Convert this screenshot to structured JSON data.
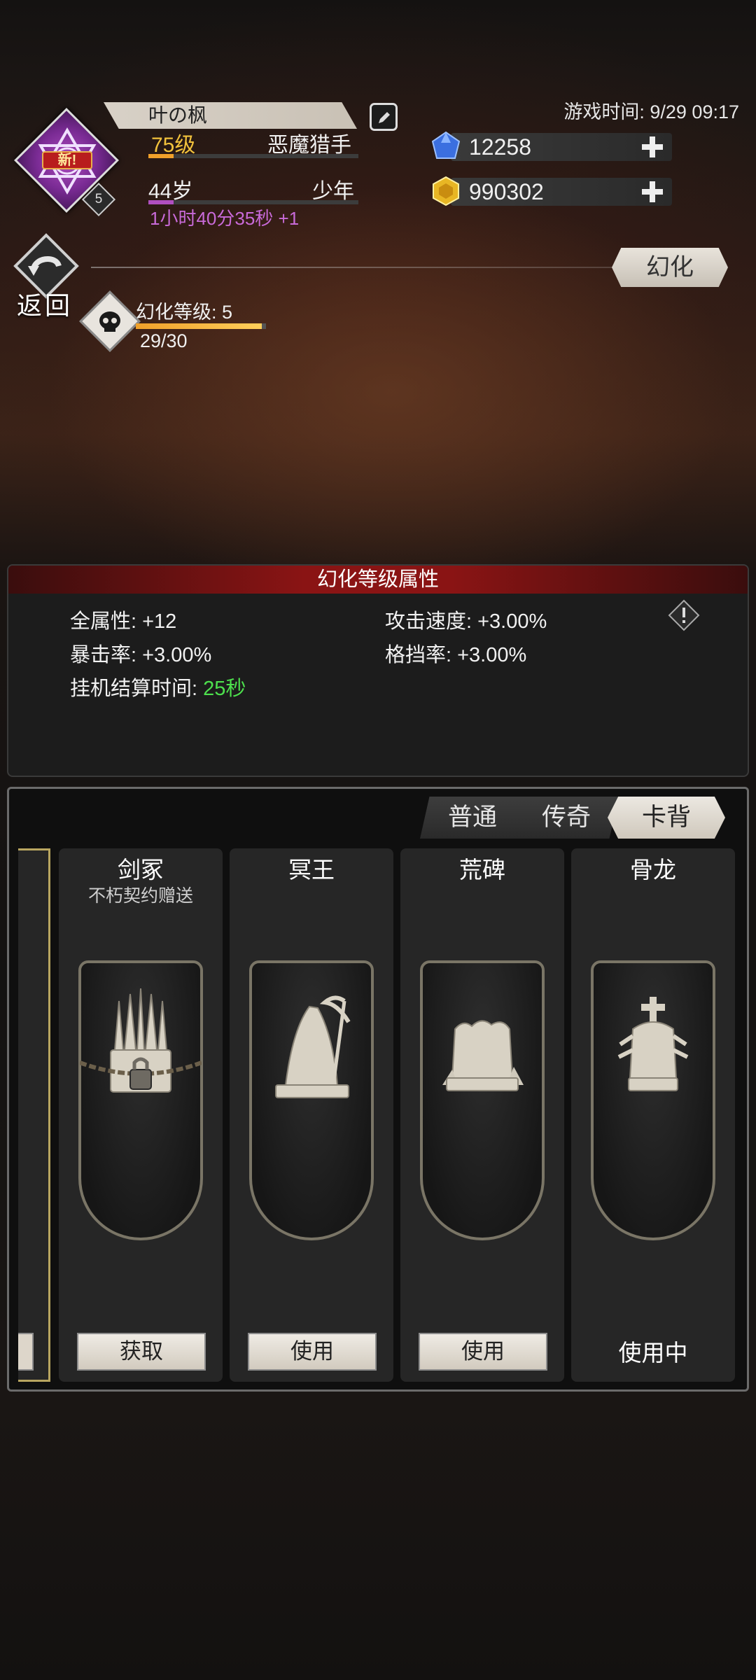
{
  "player": {
    "new_badge": "新!",
    "rank": "5",
    "name": "叶の枫",
    "level": "75级",
    "title": "恶魔猎手",
    "age": "44岁",
    "stage": "少年",
    "timer": "1小时40分35秒  +1",
    "level_progress": 0.12,
    "age_progress": 0.12
  },
  "game_time": "游戏时间: 9/29 09:17",
  "currency": {
    "gems": "12258",
    "gold": "990302"
  },
  "nav": {
    "back_label": "返回",
    "transform_button": "幻化"
  },
  "transform_level": {
    "label": "幻化等级: 5",
    "progress_text": "29/30",
    "progress": 0.967
  },
  "attributes": {
    "header": "幻化等级属性",
    "all_stats": "全属性: +12",
    "attack_speed": "攻击速度: +3.00%",
    "crit_rate": "暴击率: +3.00%",
    "block_rate": "格挡率: +3.00%",
    "idle_label": "挂机结算时间: ",
    "idle_value": "25秒"
  },
  "tabs": [
    "普通",
    "传奇",
    "卡背"
  ],
  "active_tab": "卡背",
  "cards": [
    {
      "name": "剑冢",
      "subtitle": "不朽契约赠送",
      "action": "获取",
      "icon": "sword-throne-icon"
    },
    {
      "name": "冥王",
      "subtitle": "",
      "action": "使用",
      "icon": "reaper-icon"
    },
    {
      "name": "荒碑",
      "subtitle": "",
      "action": "使用",
      "icon": "tombstone-icon"
    },
    {
      "name": "骨龙",
      "subtitle": "",
      "action": "使用中",
      "icon": "bone-altar-icon"
    }
  ],
  "colors": {
    "accent_purple": "#7a2b94",
    "header_red": "#8a1414",
    "highlight_green": "#4de04d",
    "level_gold": "#f2c23c",
    "timer_purple": "#c86ad8"
  }
}
